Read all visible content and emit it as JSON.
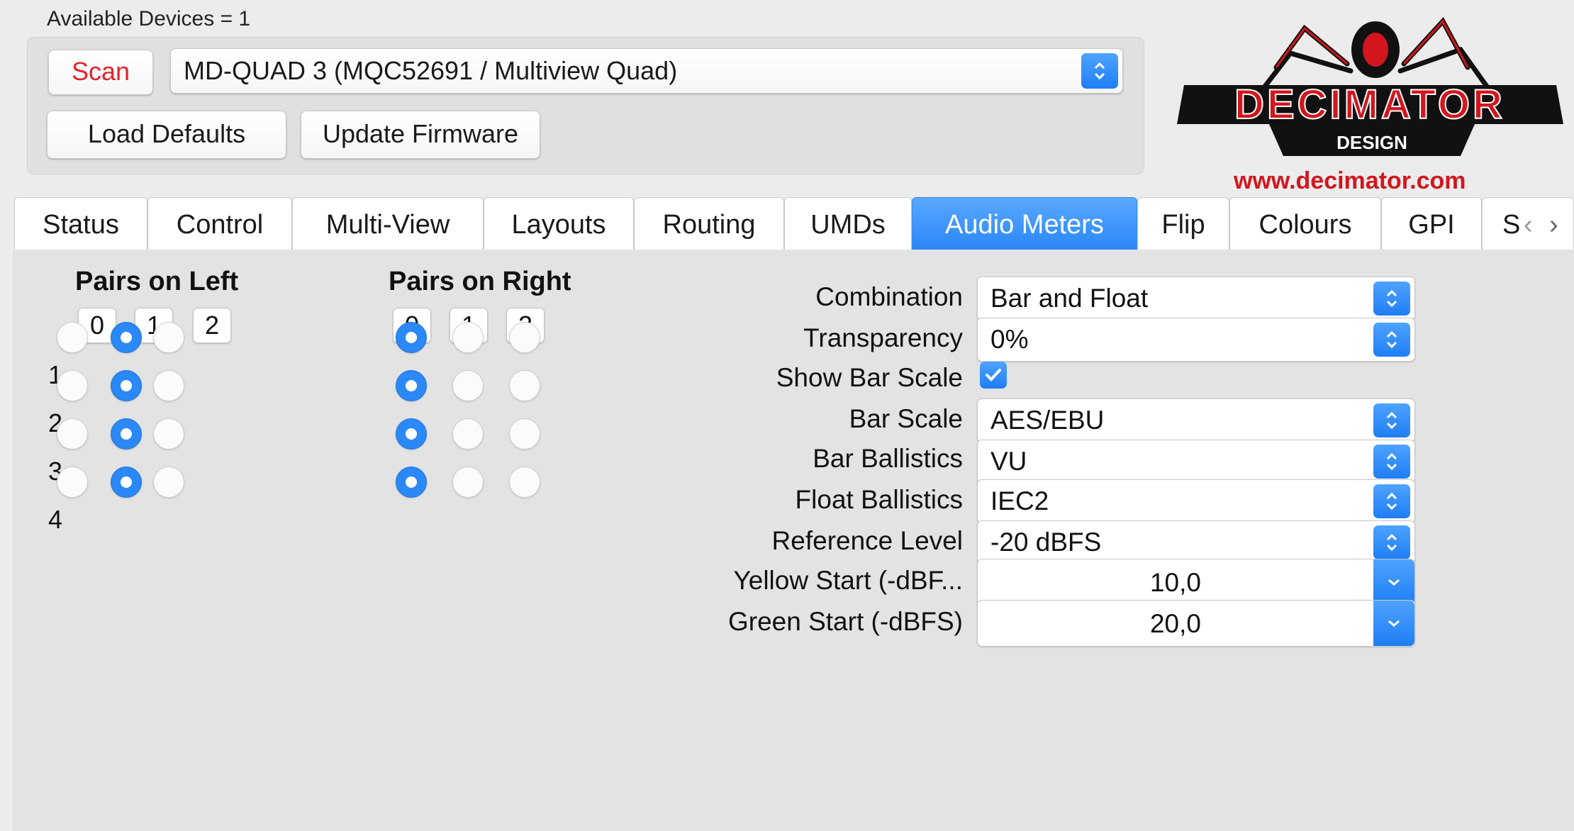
{
  "header": {
    "available_devices": "Available Devices = 1",
    "scan_label": "Scan",
    "device": "MD-QUAD 3 (MQC52691 / Multiview Quad)",
    "load_defaults_label": "Load Defaults",
    "update_firmware_label": "Update Firmware"
  },
  "logo": {
    "brand": "DECIMATOR",
    "sub": "DESIGN",
    "url": "www.decimator.com",
    "colors": {
      "red": "#d2161d",
      "black": "#111111"
    }
  },
  "tabs": [
    {
      "label": "Status"
    },
    {
      "label": "Control"
    },
    {
      "label": "Multi-View"
    },
    {
      "label": "Layouts"
    },
    {
      "label": "Routing"
    },
    {
      "label": "UMDs"
    },
    {
      "label": "Audio Meters",
      "active": true
    },
    {
      "label": "Flip"
    },
    {
      "label": "Colours"
    },
    {
      "label": "GPI"
    },
    {
      "label": "S"
    }
  ],
  "pairs_left": {
    "title": "Pairs on Left",
    "columns": [
      "0",
      "1",
      "2"
    ],
    "rows": [
      "1",
      "2",
      "3",
      "4"
    ],
    "selected_column_per_row": [
      1,
      1,
      1,
      1
    ]
  },
  "pairs_right": {
    "title": "Pairs on Right",
    "columns": [
      "0",
      "1",
      "2"
    ],
    "selected_column_per_row": [
      0,
      0,
      0,
      0
    ]
  },
  "settings": {
    "combination": {
      "label": "Combination",
      "value": "Bar and Float"
    },
    "transparency": {
      "label": "Transparency",
      "value": "0%"
    },
    "show_bar_scale": {
      "label": "Show Bar Scale",
      "checked": true
    },
    "bar_scale": {
      "label": "Bar Scale",
      "value": "AES/EBU"
    },
    "bar_ballistics": {
      "label": "Bar Ballistics",
      "value": "VU"
    },
    "float_ballistics": {
      "label": "Float Ballistics",
      "value": "IEC2"
    },
    "reference_level": {
      "label": "Reference Level",
      "value": "-20 dBFS"
    },
    "yellow_start": {
      "label": "Yellow Start (-dBF...",
      "value": "10,0"
    },
    "green_start": {
      "label": "Green Start (-dBFS)",
      "value": "20,0"
    }
  },
  "colors": {
    "accent": "#2b88f7",
    "scan_text": "#e0242b"
  }
}
